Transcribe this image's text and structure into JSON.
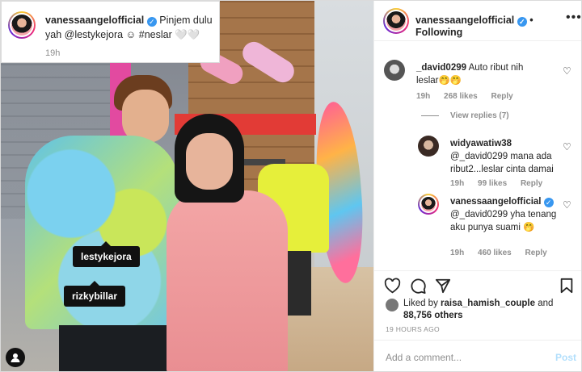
{
  "post": {
    "username": "vanessaangelofficial",
    "follow_label": "Following",
    "more_label": "•••",
    "caption": "Pinjem dulu yah @lestykejora ☺ #neslar 🤍🤍",
    "caption_time": "19h",
    "verified_mark": "✓"
  },
  "photo_tags": [
    "lestykejora",
    "rizkybillar"
  ],
  "comments": [
    {
      "user": "_david0299",
      "text": "Auto ribut nih leslar🤭🤭",
      "time": "19h",
      "likes": "268 likes",
      "reply": "Reply"
    },
    {
      "user": "widyawatiw38",
      "text": "@_david0299 mana ada ribut2...leslar cinta damai",
      "time": "19h",
      "likes": "99 likes",
      "reply": "Reply"
    },
    {
      "user": "vanessaangelofficial",
      "text": "@_david0299 yha tenang aku punya suami 🤭",
      "time": "19h",
      "likes": "460 likes",
      "reply": "Reply"
    }
  ],
  "view_replies": "View replies (7)",
  "likes_summary": {
    "prefix": "Liked by",
    "user": "raisa_hamish_couple",
    "middle": "and",
    "count": "88,756 others"
  },
  "posted_ago": "19 HOURS AGO",
  "add_comment": {
    "placeholder": "Add a comment...",
    "post_label": "Post"
  },
  "icons": [
    "heart-icon",
    "comment-icon",
    "share-icon",
    "bookmark-icon",
    "user-tag-icon",
    "more-icon",
    "verified-badge-icon"
  ],
  "colors": {
    "verified": "#3897f0",
    "link": "#00376b",
    "muted": "#8e8e8e",
    "post_disabled": "#b2dffc"
  }
}
